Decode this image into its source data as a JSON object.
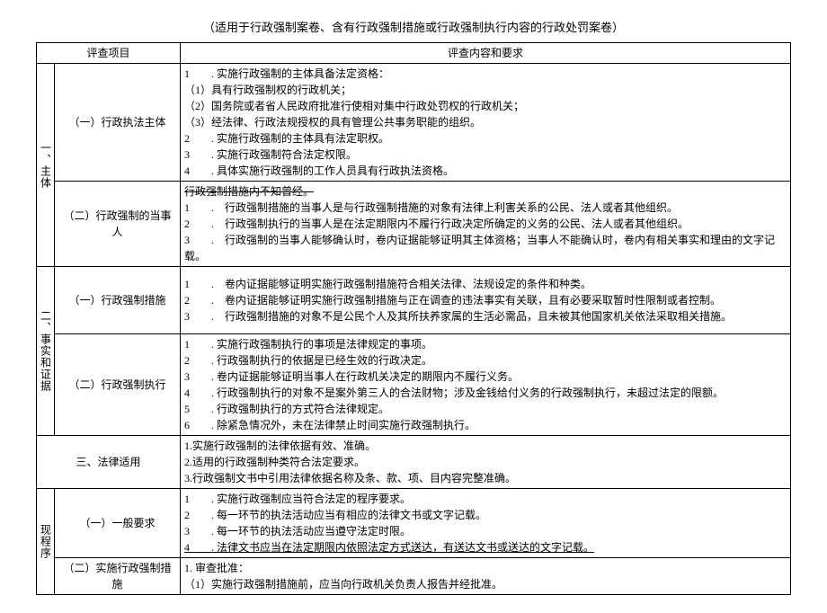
{
  "title": "（适用于行政强制案卷、含有行政强制措施或行政强制执行内容的行政处罚案卷）",
  "header": {
    "col1": "评查项目",
    "col2": "评查内容和要求"
  },
  "section1": {
    "label": "一、主体",
    "row1": {
      "label": "（一）行政执法主体",
      "item1": "1　　. 实施行政强制的主体具备法定资格：",
      "sub1": "（1）具有行政强制权的行政机关；",
      "sub2": "（2）国务院或者省人民政府批准行使相对集中行政处罚权的行政机关；",
      "sub3": "（3）经法律、行政法规授权的具有管理公共事务职能的组织。",
      "item2": "2　　. 实施行政强制的主体具有法定职权。",
      "item3": "3　　. 实施行政强制符合法定权限。",
      "item4": "4　　. 具体实施行政强制的工作人员具有行政执法资格。"
    },
    "row2": {
      "label": "（二）行政强制的当事人",
      "item0": "行政强制措施内不知曾经。",
      "item1": "1　　.　行政强制措施的当事人是与行政强制措施的对象有法律上利害关系的公民、法人或者其他组织。",
      "item2": "2　　.　行政强制执行的当事人是在法定期限内不履行行政决定所确定的义务的公民、法人或者其他组织。",
      "item3": "3　　.　行政强制的当事人能够确认时，卷内证据能够证明其主体资格；当事人不能确认时，卷内有相关事实和理由的文字记载。"
    }
  },
  "section2": {
    "label": "二、事实和证据",
    "row1": {
      "label": "（一）行政强制措施",
      "item1": "1　　.　卷内证据能够证明实施行政强制措施符合相关法律、法规设定的条件和种类。",
      "item2": "2　　.　卷内证据能够证明实施行政强制措施与正在调查的违法事实有关联，且有必要采取暂时性限制或者控制。",
      "item3": "3　　.　行政强制措施的对象不是公民个人及其所扶养家属的生活必需品，且未被其他国家机关依法采取相关措施。"
    },
    "row2": {
      "label": "（二）行政强制执行",
      "item1": "1　　. 实施行政强制执行的事项是法律规定的事项。",
      "item2": "2　　. 行政强制执行的依据是已经生效的行政决定。",
      "item3": "3　　. 卷内证据能够证明当事人在行政机关决定的期限内不履行义务。",
      "item4": "4　　. 行政强制执行的对象不是案外第三人的合法财物；涉及金钱给付义务的行政强制执行，未超过法定的限额。",
      "item5": "5　　. 行政强制执行的方式符合法律规定。",
      "item6": "6　　. 除紧急情况外，未在法律禁止时间实施行政强制执行。"
    }
  },
  "section3": {
    "label": "三、法律适用",
    "item1": "1.实施行政强制的法律依据有效、准确。",
    "item2": "2.适用的行政强制种类符合法定要求。",
    "item3": "3.行政强制文书中引用法律依据名称及条、款、项、目内容完整准确。"
  },
  "section4": {
    "label": "现程序",
    "row1": {
      "label": "（一）一般要求",
      "item1": "1　　. 实施行政强制应当符合法定的程序要求。",
      "item2": "2　　. 每一环节的执法活动应当有相应的法律文书或文字记载。",
      "item3": "3　　. 每一环节的执法活动应当遵守法定时限。",
      "item4": "4　　. 法律文书应当在法定期限内依照法定方式送达，有送达文书或送达的文字记载。"
    },
    "row2": {
      "label": "（二）实施行政强制措施",
      "item1": "1. 审查批准：",
      "sub1": "（1）实施行政强制措施前，应当向行政机关负责人报告并经批准。"
    }
  }
}
